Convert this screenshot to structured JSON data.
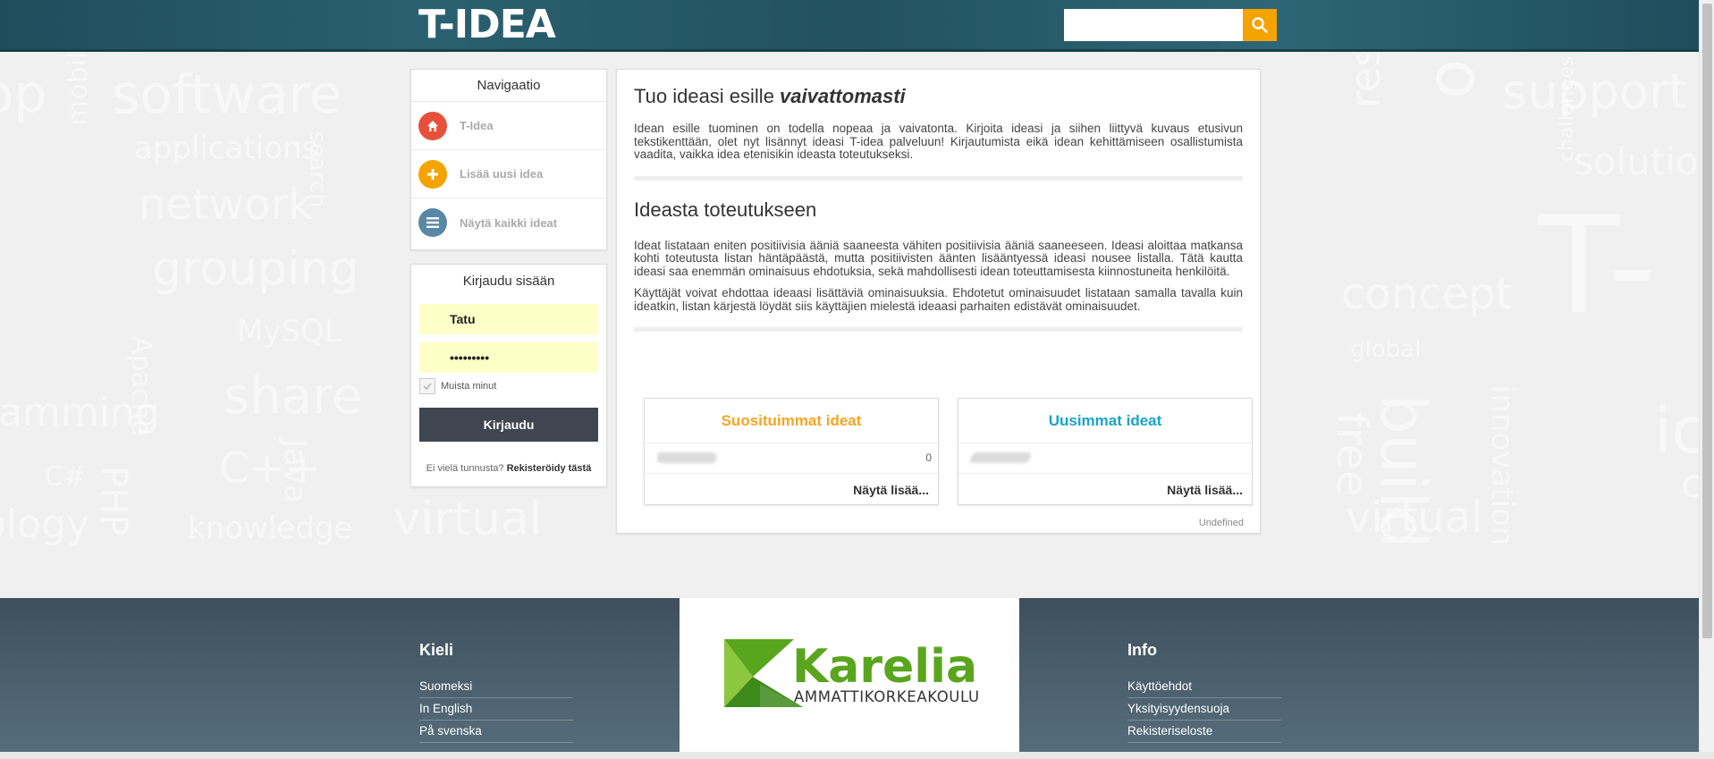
{
  "header": {
    "logo_text": "T-IDEA",
    "search_placeholder": ""
  },
  "background_words": [
    "op",
    "software",
    "mobile",
    "applications",
    "search",
    "network",
    "grouping",
    "MySQL",
    "share",
    "Apache",
    "ramming",
    "C++",
    "Java",
    "C#",
    "PHP",
    "ology",
    "knowledge",
    "virtual",
    "support",
    "research",
    "online",
    "solution",
    "challenges",
    "concept",
    "global",
    "free",
    "build",
    "innovation",
    "T-",
    "ic",
    "co",
    "virtual"
  ],
  "nav": {
    "title": "Navigaatio",
    "items": [
      {
        "label": "T-Idea",
        "color": "#e8503a"
      },
      {
        "label": "Lisää uusi idea",
        "color": "#f5a300"
      },
      {
        "label": "Näytä kaikki ideat",
        "color": "#5a87a5"
      }
    ]
  },
  "login": {
    "title": "Kirjaudu sisään",
    "username_value": "Tatu",
    "password_value": "•••••••••",
    "remember_label": "Muista minut",
    "button_label": "Kirjaudu",
    "register_prompt": "Ei vielä tunnusta?",
    "register_link": "Rekisteröidy tästä"
  },
  "main": {
    "heading1_prefix": "Tuo ideasi esille ",
    "heading1_emph": "vaivattomasti",
    "para1": "Idean esille tuominen on todella nopeaa ja vaivatonta. Kirjoita ideasi ja siihen liittyvä kuvaus etusivun tekstikenttään, olet nyt lisännyt ideasi T-idea palveluun! Kirjautumista eikä idean kehittämiseen osallistumista vaadita, vaikka idea etenisikin ideasta toteutukseksi.",
    "heading2": "Ideasta toteutukseen",
    "para2": "Ideat listataan eniten positiivisia ääniä saaneesta vähiten positiivisia ääniä saaneeseen. Ideasi aloittaa matkansa kohti toteutusta listan häntäpäästä, mutta positiivisten äänten lisääntyessä ideasi nousee listalla. Tätä kautta ideasi saa enemmän ominaisuus ehdotuksia, sekä mahdollisesti idean toteuttamisesta kiinnostuneita henkilöitä.",
    "para3": "Käyttäjät voivat ehdottaa ideaasi lisättäviä ominaisuuksia. Ehdotetut ominaisuudet listataan samalla tavalla kuin ideatkin, listan kärjestä löydät siis käyttäjien mielestä ideaasi parhaiten edistävät ominaisuudet.",
    "cards": [
      {
        "title": "Suosituimmat ideat",
        "color": "#f5a623",
        "count": "0",
        "more": "Näytä lisää..."
      },
      {
        "title": "Uusimmat ideat",
        "color": "#1aa3c8",
        "count": "",
        "more": "Näytä lisää..."
      }
    ],
    "undefined_label": "Undefined"
  },
  "footer": {
    "lang_heading": "Kieli",
    "lang_links": [
      "Suomeksi",
      "In English",
      "På svenska"
    ],
    "info_heading": "Info",
    "info_links": [
      "Käyttöehdot",
      "Yksityisyydensuoja",
      "Rekisteriseloste"
    ],
    "logo_name": "Karelia",
    "logo_sub": "AMMATTIKORKEAKOULU",
    "logo_color": "#5aa51e"
  }
}
